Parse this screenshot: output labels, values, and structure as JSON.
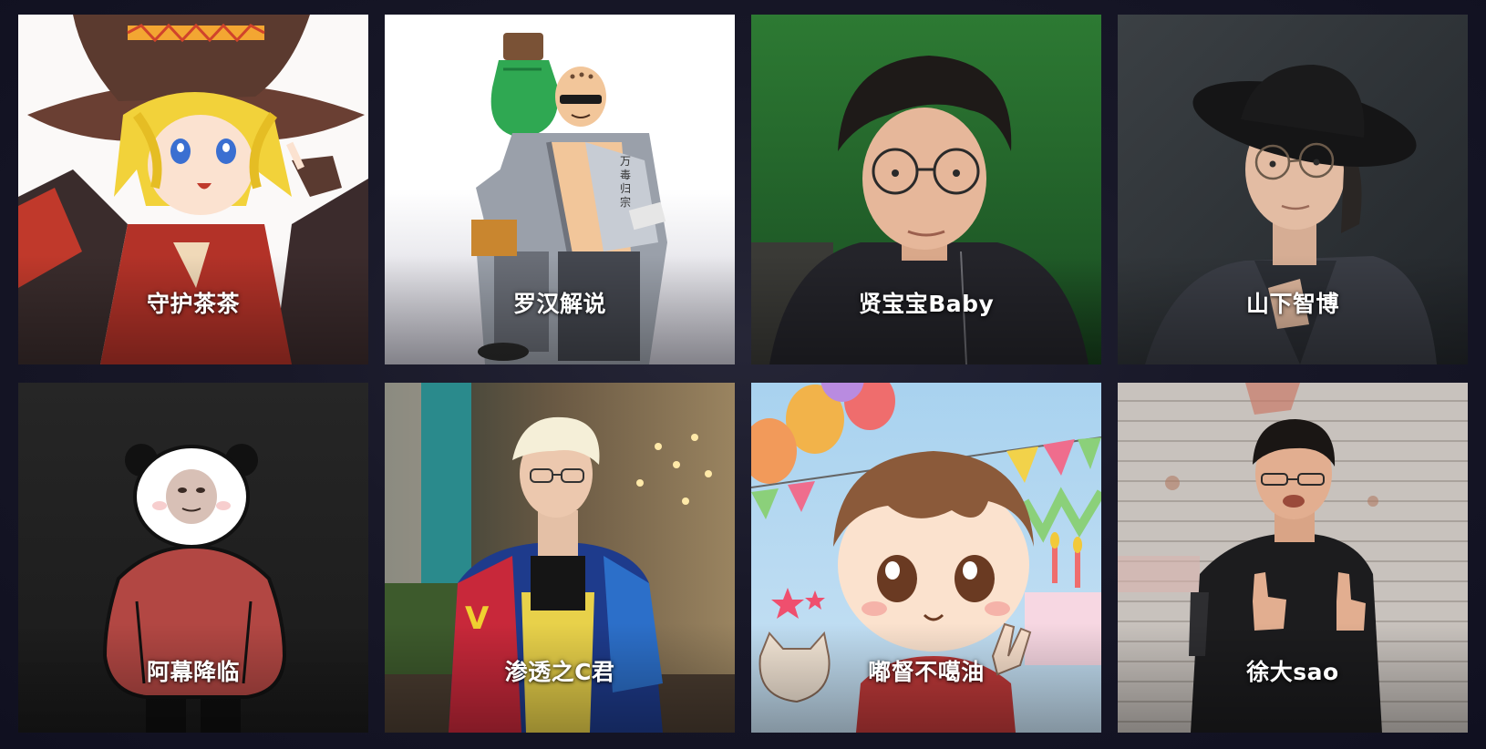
{
  "hosts": [
    {
      "name": "守护茶茶"
    },
    {
      "name": "罗汉解说"
    },
    {
      "name": "贤宝宝Baby"
    },
    {
      "name": "山下智博"
    },
    {
      "name": "阿幕降临"
    },
    {
      "name": "渗透之C君"
    },
    {
      "name": "嘟督不噶油"
    },
    {
      "name": "徐大sao"
    }
  ],
  "colors": {
    "page_background": "#181828",
    "name_text": "#ffffff"
  }
}
